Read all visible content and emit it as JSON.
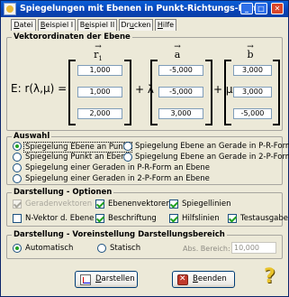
{
  "window": {
    "title": "Spiegelungen mit Ebenen in Punkt-Richtungs-Form"
  },
  "titlebar_buttons": {
    "minimize": "_",
    "maximize": "□",
    "close": "✕"
  },
  "menu": {
    "datei": {
      "pre": "",
      "u": "D",
      "post": "atei"
    },
    "beispiel1": {
      "pre": "",
      "u": "B",
      "post": "eispiel I"
    },
    "beispiel2": {
      "pre": "B",
      "u": "e",
      "post": "ispiel II"
    },
    "drucken": {
      "pre": "Dr",
      "u": "u",
      "post": "cken"
    },
    "hilfe": {
      "pre": "",
      "u": "H",
      "post": "ilfe"
    }
  },
  "vectors": {
    "label": "Vektorordinaten der Ebene",
    "equation_lhs": "E: r(λ,μ) =",
    "r1": {
      "symbol": "r",
      "sub": "1",
      "values": [
        "1,000",
        "1,000",
        "2,000"
      ]
    },
    "a": {
      "symbol": "a",
      "values": [
        "-5,000",
        "-5,000",
        "3,000"
      ]
    },
    "b": {
      "symbol": "b",
      "values": [
        "3,000",
        "3,000",
        "-5,000"
      ]
    },
    "plus_lambda": "+ λ ·",
    "plus_mu": "+ μ ·"
  },
  "auswahl": {
    "label": "Auswahl",
    "options": [
      "Spiegelung Ebene an Punkt",
      "Spiegelung Ebene an Gerade in P-R-Form",
      "Spiegelung Punkt an Ebene",
      "Spiegelung Ebene an Gerade in 2-P-Form",
      "Spiegelung einer Geraden in P-R-Form an Ebene",
      "Spiegelung einer Geraden in 2-P-Form an Ebene"
    ],
    "selected": "Spiegelung Ebene an Punkt"
  },
  "darstellung": {
    "label": "Darstellung - Optionen",
    "geradenvektoren": "Geradenvektoren",
    "ebenenvektoren": "Ebenenvektoren",
    "spiegellinien": "Spiegellinien",
    "nvektor": "N-Vektor d. Ebene",
    "beschriftung": "Beschriftung",
    "hilfslinien": "Hilfslinien",
    "testausgabe": "Testausgabe"
  },
  "voreinstellung": {
    "label": "Darstellung - Voreinstellung Darstellungsbereich",
    "automatisch": "Automatisch",
    "statisch": "Statisch",
    "selected": "Automatisch",
    "abs_bereich_label": "Abs. Bereich:",
    "abs_bereich_value": "10,000"
  },
  "buttons": {
    "darstellen": {
      "pre": "",
      "u": "D",
      "post": "arstellen"
    },
    "beenden": {
      "pre": "",
      "u": "B",
      "post": "eenden"
    }
  },
  "help": {
    "glyph": "?"
  }
}
